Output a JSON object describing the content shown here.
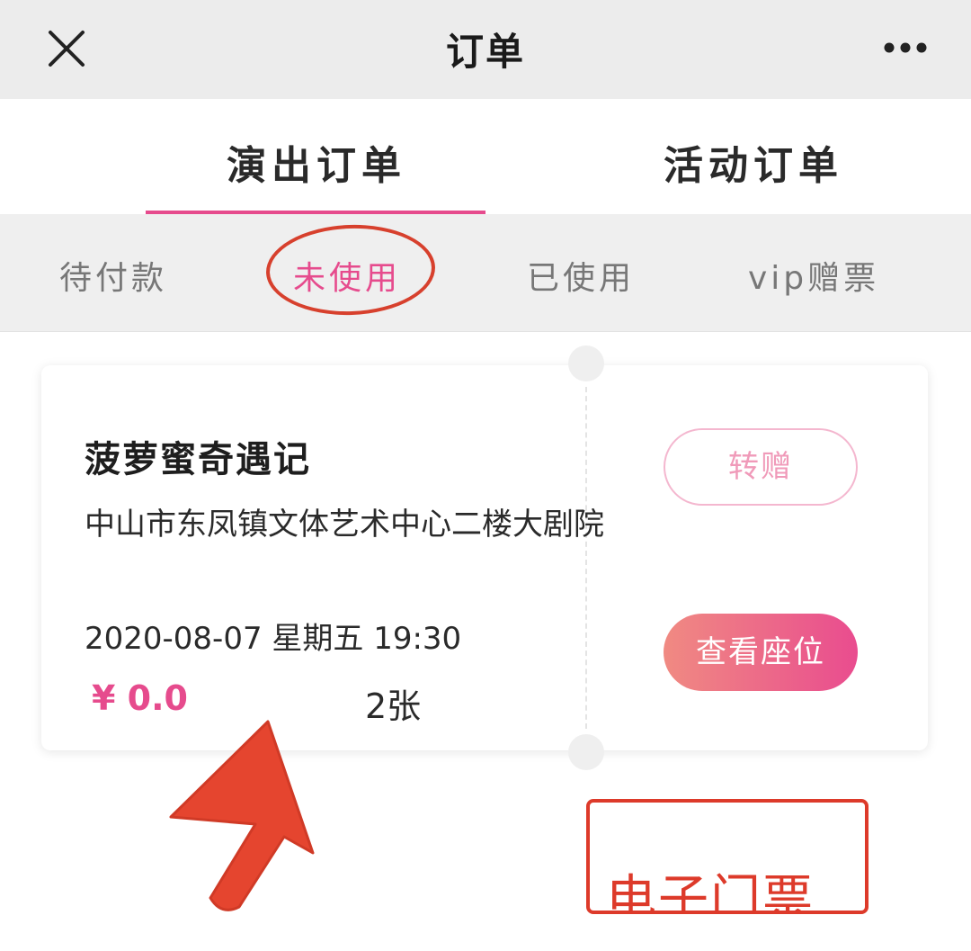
{
  "topbar": {
    "title": "订单",
    "close_icon": "close-icon",
    "more_icon": "more-icon"
  },
  "tabs": [
    {
      "label": "演出订单",
      "active": true
    },
    {
      "label": "活动订单",
      "active": false
    }
  ],
  "subtabs": [
    {
      "label": "待付款",
      "active": false
    },
    {
      "label": "未使用",
      "active": true
    },
    {
      "label": "已使用",
      "active": false
    },
    {
      "label": "vip赠票",
      "active": false
    }
  ],
  "order": {
    "title": "菠萝蜜奇遇记",
    "venue": "中山市东凤镇文体艺术中心二楼大剧院",
    "datetime": "2020-08-07 星期五 19:30",
    "price": "¥ 0.0",
    "quantity": "2张",
    "gift_button": "转赠",
    "seat_button": "查看座位"
  },
  "annotation": {
    "label": "电子门票",
    "color": "#dd3a2a"
  },
  "colors": {
    "accent": "#e64b8d",
    "annotation_red": "#dd3a2a"
  }
}
